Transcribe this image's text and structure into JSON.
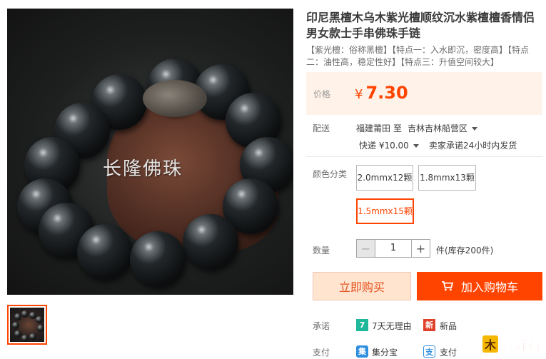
{
  "product": {
    "title": "印尼黑檀木乌木紫光檀顺纹沉水紫檀檀香情侣男女款士手串佛珠手链",
    "subtitle": "【紫光檀：俗称黑檀】【特点一：入水即沉，密度高】【特点二：油性高，稳定性好】【特点三：升值空间较大】",
    "image_watermark": "长隆佛珠"
  },
  "price": {
    "label": "价格",
    "currency": "¥",
    "value": "7.30",
    "color": "#ff4400"
  },
  "shipping": {
    "label": "配送",
    "origin": "福建莆田",
    "to": "至",
    "destination": "吉林吉林船营区",
    "method": "快递 ¥10.00",
    "promise": "卖家承诺24小时内发货"
  },
  "sku": {
    "label": "颜色分类",
    "options": [
      "2.0mmx12颗",
      "1.8mmx13颗",
      "1.5mmx15颗"
    ],
    "selected": "1.5mmx15颗"
  },
  "quantity": {
    "label": "数量",
    "value": "1",
    "minus": "−",
    "plus": "+",
    "stock": "件(库存200件)"
  },
  "actions": {
    "buy_now": "立即购买",
    "add_to_cart": "加入购物车"
  },
  "promise": {
    "label": "承诺",
    "items": [
      {
        "icon": "7",
        "text": "7天无理由"
      },
      {
        "icon": "新",
        "text": "新品"
      }
    ]
  },
  "payment": {
    "label": "支付",
    "items": [
      {
        "icon": "集",
        "text": "集分宝"
      },
      {
        "icon": "支",
        "text": "支付"
      }
    ]
  },
  "watermark_logo": "爱好者"
}
